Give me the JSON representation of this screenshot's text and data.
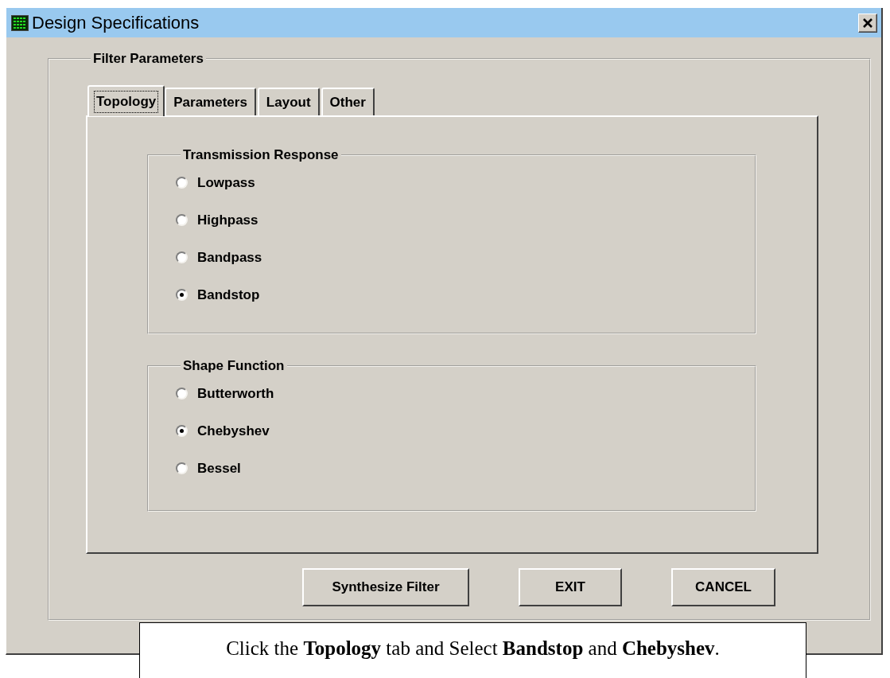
{
  "window": {
    "title": "Design Specifications"
  },
  "group": {
    "title": "Filter Parameters"
  },
  "tabs": [
    {
      "label": "Topology",
      "selected": true
    },
    {
      "label": "Parameters",
      "selected": false
    },
    {
      "label": "Layout",
      "selected": false
    },
    {
      "label": "Other",
      "selected": false
    }
  ],
  "sections": [
    {
      "title": "Transmission Response",
      "options": [
        {
          "label": "Lowpass",
          "selected": false
        },
        {
          "label": "Highpass",
          "selected": false
        },
        {
          "label": "Bandpass",
          "selected": false
        },
        {
          "label": "Bandstop",
          "selected": true
        }
      ]
    },
    {
      "title": "Shape Function",
      "options": [
        {
          "label": "Butterworth",
          "selected": false
        },
        {
          "label": "Chebyshev",
          "selected": true
        },
        {
          "label": "Bessel",
          "selected": false
        }
      ]
    }
  ],
  "buttons": [
    "Synthesize Filter",
    "EXIT",
    "CANCEL"
  ],
  "callout": "Click the **Topology** tab and Select **Bandstop** and **Chebyshev**."
}
